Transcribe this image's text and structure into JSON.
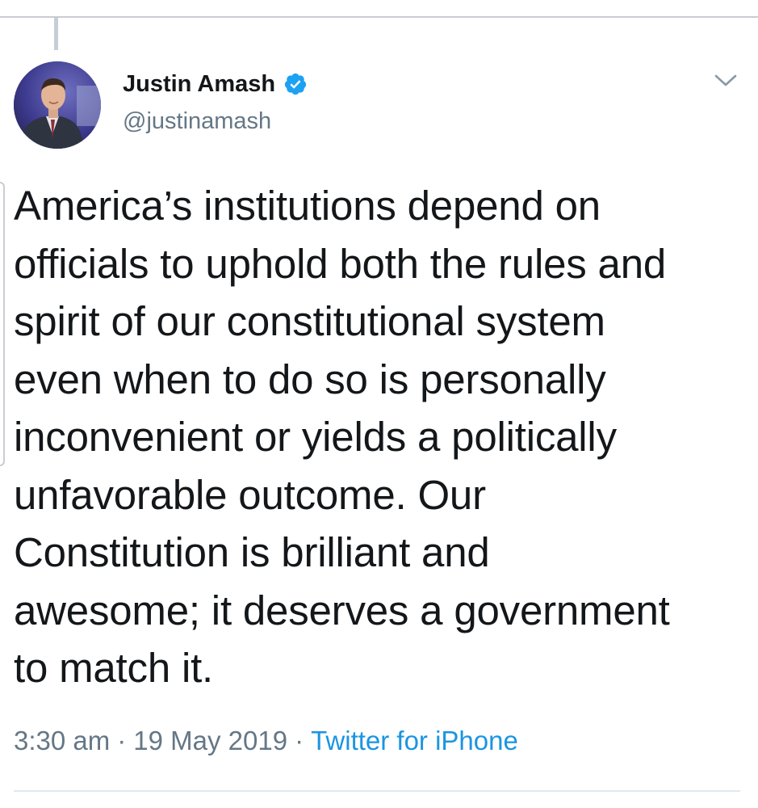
{
  "author": {
    "display_name": "Justin Amash",
    "username": "@justinamash",
    "verified": true,
    "avatar_icon": "profile-photo"
  },
  "tweet": {
    "text": "America’s institutions depend on\nofficials to uphold both the rules and\nspirit of our constitutional system\neven when to do so is personally\ninconvenient or yields a politically\nunfavorable outcome. Our\nConstitution is brilliant and\nawesome; it deserves a government\nto match it."
  },
  "meta": {
    "time": "3:30 am",
    "separator": "·",
    "date": "19 May 2019",
    "source": "Twitter for iPhone"
  },
  "colors": {
    "text": "#14171a",
    "secondary": "#657786",
    "link": "#1b95e0",
    "verified": "#1da1f2"
  },
  "icons": {
    "verified": "verified-badge-icon",
    "more": "chevron-down-icon"
  }
}
